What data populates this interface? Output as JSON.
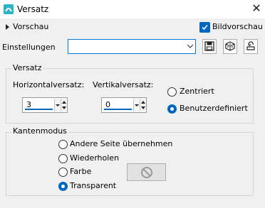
{
  "window": {
    "title": "Versatz",
    "close_glyph": "✕",
    "icon": "app-logo-icon"
  },
  "toolbar": {
    "preview_label": "Vorschau",
    "preview_checkbox_label": "Bildvorschau",
    "preview_checked": true,
    "settings_label": "Einstellungen",
    "settings_value": "",
    "buttons": [
      "save-preset-icon",
      "random-icon",
      "reset-icon"
    ]
  },
  "offset_group": {
    "title": "Versatz",
    "horizontal_label": "Horizontalversatz:",
    "horizontal_value": "3",
    "vertical_label": "Vertikalversatz:",
    "vertical_value": "0",
    "options": [
      {
        "label": "Zentriert",
        "selected": false
      },
      {
        "label": "Benutzerdefiniert",
        "selected": true
      }
    ]
  },
  "edge_group": {
    "title": "Kantenmodus",
    "options": [
      {
        "label": "Andere Seite übernehmen",
        "selected": false
      },
      {
        "label": "Wiederholen",
        "selected": false
      },
      {
        "label": "Farbe",
        "selected": false
      },
      {
        "label": "Transparent",
        "selected": true
      }
    ],
    "color_swatch_icon": "no-color-icon"
  },
  "colors": {
    "accent": "#0067c0",
    "background": "#f0f0f0"
  }
}
